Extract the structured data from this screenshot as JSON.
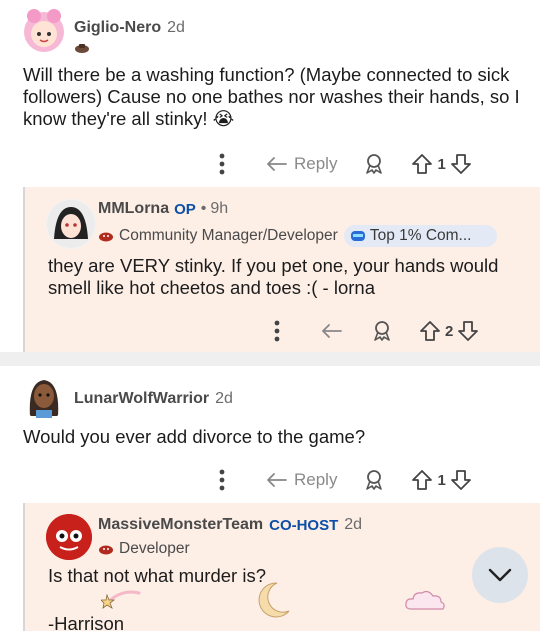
{
  "comments": [
    {
      "author": "Giglio-Nero",
      "age": "2d",
      "text": "Will there be a washing function? (Maybe connected to sick followers) Cause no one bathes nor washes their hands, so I know they're all stinky! 😭",
      "reply_label": "Reply",
      "votes": "1",
      "reply": {
        "author": "MMLorna",
        "op_badge": "OP",
        "sep": "•",
        "age": "9h",
        "flair": "Community Manager/Developer",
        "badge": "Top 1% Com...",
        "text": "they are VERY stinky. If you pet one, your hands would smell like hot cheetos and toes :( - lorna",
        "votes": "2"
      }
    },
    {
      "author": "LunarWolfWarrior",
      "age": "2d",
      "text": "Would you ever add divorce to the game?",
      "reply_label": "Reply",
      "votes": "1",
      "reply": {
        "author": "MassiveMonsterTeam",
        "cohost_badge": "CO-HOST",
        "age": "2d",
        "flair": "Developer",
        "text": "Is that not what murder is?",
        "signature": "-Harrison"
      }
    }
  ],
  "icons": [
    "more-icon",
    "reply-arrow-icon",
    "award-icon",
    "upvote-icon",
    "downvote-icon",
    "chevron-down-icon"
  ],
  "colors": {
    "accent_blue": "#0d4fa6",
    "reply_bg": "#fdeee6",
    "badge_bg": "#e3e9f5",
    "fab_bg": "#dde3eb"
  }
}
